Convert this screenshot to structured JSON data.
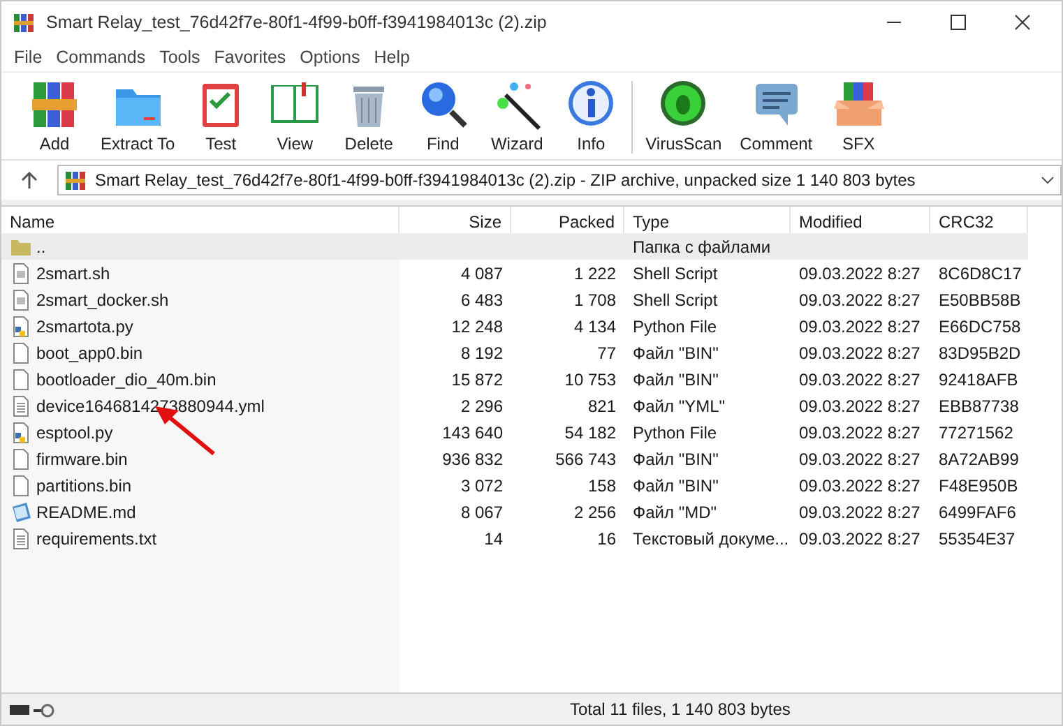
{
  "window": {
    "title": "Smart Relay_test_76d42f7e-80f1-4f99-b0ff-f3941984013c (2).zip"
  },
  "menu": [
    "File",
    "Commands",
    "Tools",
    "Favorites",
    "Options",
    "Help"
  ],
  "toolbar": [
    {
      "label": "Add"
    },
    {
      "label": "Extract To"
    },
    {
      "label": "Test"
    },
    {
      "label": "View"
    },
    {
      "label": "Delete"
    },
    {
      "label": "Find"
    },
    {
      "label": "Wizard"
    },
    {
      "label": "Info"
    },
    {
      "label": "VirusScan"
    },
    {
      "label": "Comment"
    },
    {
      "label": "SFX"
    }
  ],
  "address": "Smart Relay_test_76d42f7e-80f1-4f99-b0ff-f3941984013c (2).zip - ZIP archive, unpacked size 1 140 803 bytes",
  "table": {
    "columns": [
      "Name",
      "Size",
      "Packed",
      "Type",
      "Modified",
      "CRC32"
    ],
    "rows": [
      {
        "kind": "folder",
        "selected": true,
        "cells": [
          "..",
          "",
          "",
          "Папка с файлами",
          "",
          ""
        ]
      },
      {
        "kind": "script",
        "selected": false,
        "cells": [
          "2smart.sh",
          "4 087",
          "1 222",
          "Shell Script",
          "09.03.2022 8:27",
          "8C6D8C17"
        ]
      },
      {
        "kind": "script",
        "selected": false,
        "cells": [
          "2smart_docker.sh",
          "6 483",
          "1 708",
          "Shell Script",
          "09.03.2022 8:27",
          "E50BB58B"
        ]
      },
      {
        "kind": "python",
        "selected": false,
        "cells": [
          "2smartota.py",
          "12 248",
          "4 134",
          "Python File",
          "09.03.2022 8:27",
          "E66DC758"
        ]
      },
      {
        "kind": "file",
        "selected": false,
        "cells": [
          "boot_app0.bin",
          "8 192",
          "77",
          "Файл \"BIN\"",
          "09.03.2022 8:27",
          "83D95B2D"
        ]
      },
      {
        "kind": "file",
        "selected": false,
        "cells": [
          "bootloader_dio_40m.bin",
          "15 872",
          "10 753",
          "Файл \"BIN\"",
          "09.03.2022 8:27",
          "92418AFB"
        ]
      },
      {
        "kind": "text",
        "selected": false,
        "cells": [
          "device1646814273880944.yml",
          "2 296",
          "821",
          "Файл \"YML\"",
          "09.03.2022 8:27",
          "EBB87738"
        ]
      },
      {
        "kind": "python",
        "selected": false,
        "cells": [
          "esptool.py",
          "143 640",
          "54 182",
          "Python File",
          "09.03.2022 8:27",
          "77271562"
        ]
      },
      {
        "kind": "file",
        "selected": false,
        "cells": [
          "firmware.bin",
          "936 832",
          "566 743",
          "Файл \"BIN\"",
          "09.03.2022 8:27",
          "8A72AB99"
        ]
      },
      {
        "kind": "file",
        "selected": false,
        "cells": [
          "partitions.bin",
          "3 072",
          "158",
          "Файл \"BIN\"",
          "09.03.2022 8:27",
          "F48E950B"
        ]
      },
      {
        "kind": "markdown",
        "selected": false,
        "cells": [
          "README.md",
          "8 067",
          "2 256",
          "Файл \"MD\"",
          "09.03.2022 8:27",
          "6499FAF6"
        ]
      },
      {
        "kind": "text",
        "selected": false,
        "cells": [
          "requirements.txt",
          "14",
          "16",
          "Текстовый докуме...",
          "09.03.2022 8:27",
          "55354E37"
        ]
      }
    ]
  },
  "status_bar": "Total 11 files, 1 140 803 bytes"
}
